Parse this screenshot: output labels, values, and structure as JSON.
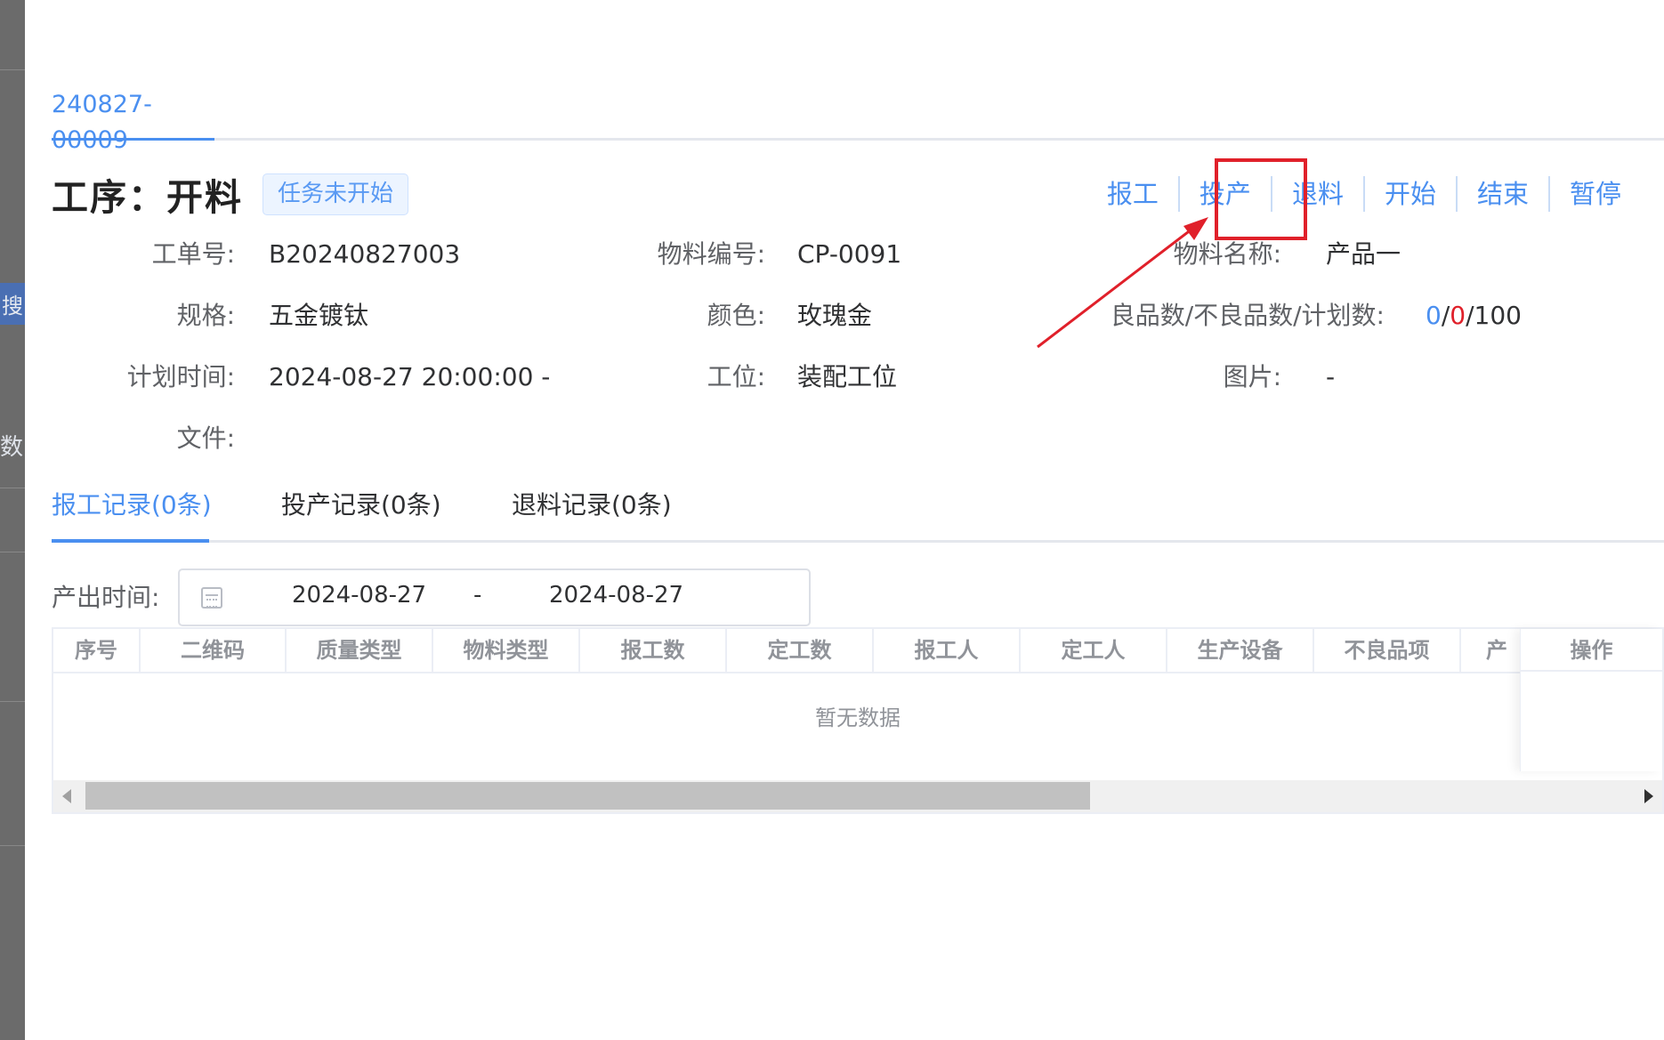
{
  "background_fragments": {
    "search_fragment": "搜",
    "count_fragment": "数"
  },
  "order_tab": "240827-00009",
  "process_title": "工序：开料",
  "status_tag": "任务未开始",
  "actions": [
    "报工",
    "投产",
    "退料",
    "开始",
    "结束",
    "暂停"
  ],
  "info": {
    "work_order": {
      "label": "工单号:",
      "value": "B20240827003"
    },
    "material_code": {
      "label": "物料编号:",
      "value": "CP-0091"
    },
    "material_name": {
      "label": "物料名称:",
      "value": "产品一"
    },
    "spec": {
      "label": "规格:",
      "value": "五金镀钛"
    },
    "color": {
      "label": "颜色:",
      "value": "玫瑰金"
    },
    "quantity": {
      "label": "良品数/不良品数/计划数:",
      "good": "0",
      "bad": "0",
      "plan": "100"
    },
    "plan_time": {
      "label": "计划时间:",
      "value": "2024-08-27 20:00:00 -"
    },
    "station": {
      "label": "工位:",
      "value": "装配工位"
    },
    "image": {
      "label": "图片:",
      "value": "-"
    },
    "file": {
      "label": "文件:"
    }
  },
  "record_tabs": [
    "报工记录(0条)",
    "投产记录(0条)",
    "退料记录(0条)"
  ],
  "filter": {
    "label": "产出时间:",
    "start": "2024-08-27",
    "separator": "-",
    "end": "2024-08-27"
  },
  "table": {
    "columns": [
      "序号",
      "二维码",
      "质量类型",
      "物料类型",
      "报工数",
      "定工数",
      "报工人",
      "定工人",
      "生产设备",
      "不良品项",
      "产"
    ],
    "fixed_column": "操作",
    "empty_text": "暂无数据",
    "scroll_fraction": 0.64
  },
  "colors": {
    "primary": "#4a8ff0",
    "bad": "#e0202a",
    "highlight": "#e0202a"
  }
}
